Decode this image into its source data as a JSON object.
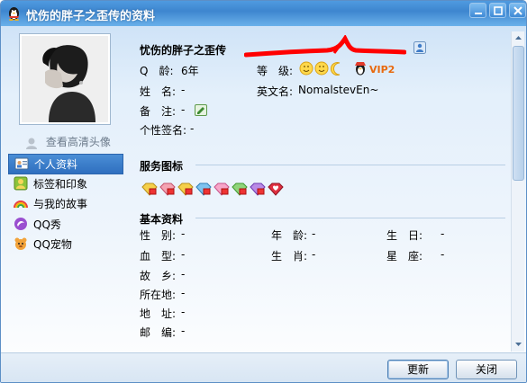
{
  "window": {
    "title": "忧伤的胖子之歪传的资料"
  },
  "sidebar": {
    "view_hd_avatar": "查看高清头像",
    "items": [
      {
        "label": "个人资料",
        "icon": "profile-card-icon",
        "active": true
      },
      {
        "label": "标签和印象",
        "icon": "tag-icon",
        "active": false
      },
      {
        "label": "与我的故事",
        "icon": "rainbow-icon",
        "active": false
      },
      {
        "label": "QQ秀",
        "icon": "qq-show-icon",
        "active": false
      },
      {
        "label": "QQ宠物",
        "icon": "qq-pet-icon",
        "active": false
      }
    ]
  },
  "profile": {
    "nickname": "忧伤的胖子之歪传",
    "qage_label": "Q　龄:",
    "qage_value": "6年",
    "level_label": "等　级:",
    "vip_badge": "VIP2",
    "name_label": "姓　名:",
    "name_value": "-",
    "english_label": "英文名:",
    "english_value": "NomalstevEn~",
    "note_label": "备　注:",
    "note_value": "-",
    "signature_label": "个性签名:",
    "signature_value": "-"
  },
  "services": {
    "title": "服务图标"
  },
  "basic": {
    "title": "基本资料",
    "rows": [
      [
        {
          "label": "性　别:",
          "value": "-"
        },
        {
          "label": "年　龄:",
          "value": "-"
        },
        {
          "label": "生　日:",
          "value": "-"
        }
      ],
      [
        {
          "label": "血　型:",
          "value": "-"
        },
        {
          "label": "生　肖:",
          "value": "-"
        },
        {
          "label": "星　座:",
          "value": "-"
        }
      ],
      [
        {
          "label": "故　乡:",
          "value": "-"
        }
      ],
      [
        {
          "label": "所在地:",
          "value": "-"
        }
      ],
      [
        {
          "label": "地　址:",
          "value": "-"
        }
      ],
      [
        {
          "label": "邮　编:",
          "value": "-"
        }
      ]
    ]
  },
  "footer": {
    "update_button": "更新",
    "close_button": "关闭"
  },
  "colors": {
    "accent": "#3e86cf",
    "active_nav": "#2f6fbf",
    "redaction": "#ff0000"
  }
}
